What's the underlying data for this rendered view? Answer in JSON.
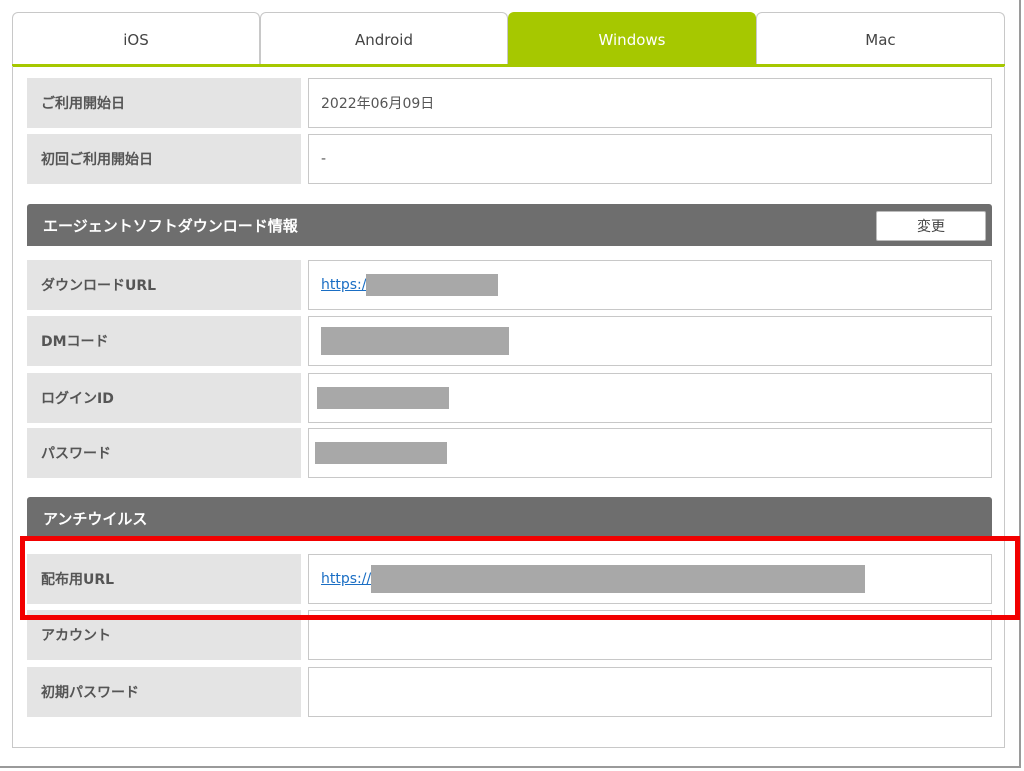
{
  "tabs": [
    {
      "label": "iOS",
      "active": false
    },
    {
      "label": "Android",
      "active": false
    },
    {
      "label": "Windows",
      "active": true
    },
    {
      "label": "Mac",
      "active": false
    }
  ],
  "general": {
    "start_date_label": "ご利用開始日",
    "start_date_value": "2022年06月09日",
    "first_use_label": "初回ご利用開始日",
    "first_use_value": "-"
  },
  "agent_section": {
    "title": "エージェントソフトダウンロード情報",
    "change_button": "変更",
    "download_url_label": "ダウンロードURL",
    "download_url_value": "https:/",
    "dm_code_label": "DMコード",
    "login_id_label": "ログインID",
    "password_label": "パスワード"
  },
  "antivirus_section": {
    "title": "アンチウイルス",
    "dist_url_label": "配布用URL",
    "dist_url_value": "https://",
    "account_label": "アカウント",
    "account_value": "",
    "initial_password_label": "初期パスワード",
    "initial_password_value": ""
  },
  "colors": {
    "active_tab": "#a6c800",
    "section_header": "#6e6e6e",
    "label_bg": "#e4e4e4",
    "highlight": "#f20000",
    "link": "#1a6ec4"
  }
}
